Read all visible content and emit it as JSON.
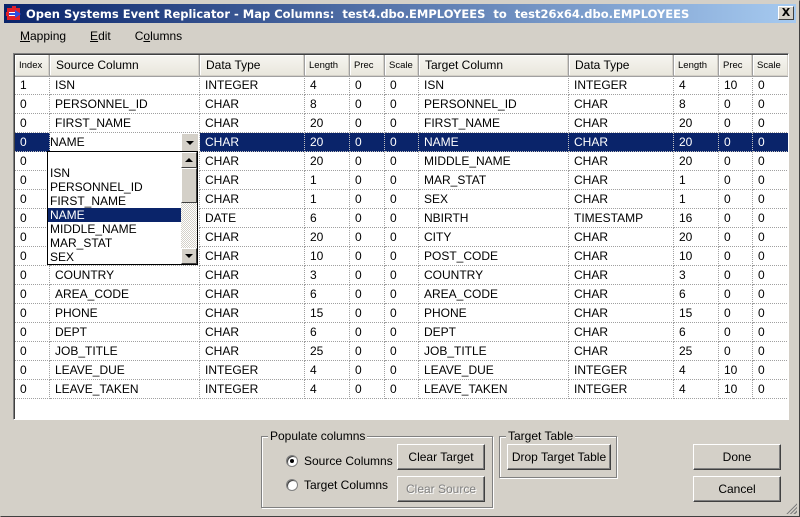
{
  "window": {
    "title": "Open Systems Event Replicator - Map Columns:  test4.dbo.EMPLOYEES  to  test26x64.dbo.EMPLOYEES",
    "close_label": "X"
  },
  "menu": [
    {
      "label": "Mapping",
      "accel_index": 0
    },
    {
      "label": "Edit",
      "accel_index": 0
    },
    {
      "label": "Columns",
      "accel_index": 1
    }
  ],
  "grid": {
    "headers": [
      "Index",
      "Source Column",
      "Data Type",
      "Length",
      "Prec",
      "Scale",
      "Target Column",
      "Data Type",
      "Length",
      "Prec",
      "Scale"
    ],
    "rows": [
      [
        "1",
        "ISN",
        "INTEGER",
        "4",
        "0",
        "0",
        "ISN",
        "INTEGER",
        "4",
        "10",
        "0"
      ],
      [
        "0",
        "PERSONNEL_ID",
        "CHAR",
        "8",
        "0",
        "0",
        "PERSONNEL_ID",
        "CHAR",
        "8",
        "0",
        "0"
      ],
      [
        "0",
        "FIRST_NAME",
        "CHAR",
        "20",
        "0",
        "0",
        "FIRST_NAME",
        "CHAR",
        "20",
        "0",
        "0"
      ],
      [
        "0",
        "NAME",
        "CHAR",
        "20",
        "0",
        "0",
        "NAME",
        "CHAR",
        "20",
        "0",
        "0"
      ],
      [
        "0",
        "",
        "CHAR",
        "20",
        "0",
        "0",
        "MIDDLE_NAME",
        "CHAR",
        "20",
        "0",
        "0"
      ],
      [
        "0",
        "",
        "CHAR",
        "1",
        "0",
        "0",
        "MAR_STAT",
        "CHAR",
        "1",
        "0",
        "0"
      ],
      [
        "0",
        "",
        "CHAR",
        "1",
        "0",
        "0",
        "SEX",
        "CHAR",
        "1",
        "0",
        "0"
      ],
      [
        "0",
        "",
        "DATE",
        "6",
        "0",
        "0",
        "NBIRTH",
        "TIMESTAMP",
        "16",
        "0",
        "0"
      ],
      [
        "0",
        "",
        "CHAR",
        "20",
        "0",
        "0",
        "CITY",
        "CHAR",
        "20",
        "0",
        "0"
      ],
      [
        "0",
        "",
        "CHAR",
        "10",
        "0",
        "0",
        "POST_CODE",
        "CHAR",
        "10",
        "0",
        "0"
      ],
      [
        "0",
        "COUNTRY",
        "CHAR",
        "3",
        "0",
        "0",
        "COUNTRY",
        "CHAR",
        "3",
        "0",
        "0"
      ],
      [
        "0",
        "AREA_CODE",
        "CHAR",
        "6",
        "0",
        "0",
        "AREA_CODE",
        "CHAR",
        "6",
        "0",
        "0"
      ],
      [
        "0",
        "PHONE",
        "CHAR",
        "15",
        "0",
        "0",
        "PHONE",
        "CHAR",
        "15",
        "0",
        "0"
      ],
      [
        "0",
        "DEPT",
        "CHAR",
        "6",
        "0",
        "0",
        "DEPT",
        "CHAR",
        "6",
        "0",
        "0"
      ],
      [
        "0",
        "JOB_TITLE",
        "CHAR",
        "25",
        "0",
        "0",
        "JOB_TITLE",
        "CHAR",
        "25",
        "0",
        "0"
      ],
      [
        "0",
        "LEAVE_DUE",
        "INTEGER",
        "4",
        "0",
        "0",
        "LEAVE_DUE",
        "INTEGER",
        "4",
        "10",
        "0"
      ],
      [
        "0",
        "LEAVE_TAKEN",
        "INTEGER",
        "4",
        "0",
        "0",
        "LEAVE_TAKEN",
        "INTEGER",
        "4",
        "10",
        "0"
      ]
    ],
    "selected_row": 3,
    "editor_value": "NAME",
    "dropdown_options": [
      "",
      "ISN",
      "PERSONNEL_ID",
      "FIRST_NAME",
      "NAME",
      "MIDDLE_NAME",
      "MAR_STAT",
      "SEX"
    ],
    "dropdown_selected": "NAME"
  },
  "populate": {
    "label": "Populate columns",
    "source_radio": "Source Columns",
    "target_radio": "Target Columns",
    "selected": "source",
    "clear_target": "Clear Target",
    "clear_source": "Clear Source"
  },
  "target_table": {
    "label": "Target Table",
    "drop_button": "Drop Target Table"
  },
  "actions": {
    "done": "Done",
    "cancel": "Cancel"
  },
  "colors": {
    "selection": "#0a246a",
    "title_start": "#0a246a",
    "title_end": "#a6caf0",
    "face": "#d4d0c8"
  }
}
